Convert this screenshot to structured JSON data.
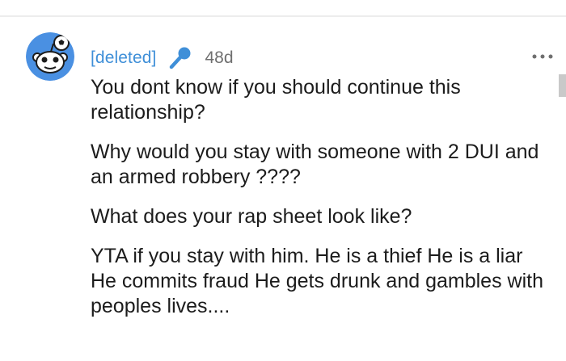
{
  "comment": {
    "username": "[deleted]",
    "timestamp": "48d",
    "icons": {
      "avatar": "snoo-avatar-icon",
      "flair": "microphone-icon",
      "more": "more-options-icon"
    },
    "colors": {
      "username": "#3f8fd8",
      "avatar_bg": "#4a90e2",
      "mic": "#3f8fd8"
    },
    "paragraphs": [
      "You dont know if you should continue this relationship?",
      "Why would you stay with someone with 2 DUI and an armed robbery ????",
      "What does your rap sheet look like?",
      "YTA if you stay with him. He is a thief He is a liar He commits fraud He gets drunk and gambles with peoples lives...."
    ]
  }
}
